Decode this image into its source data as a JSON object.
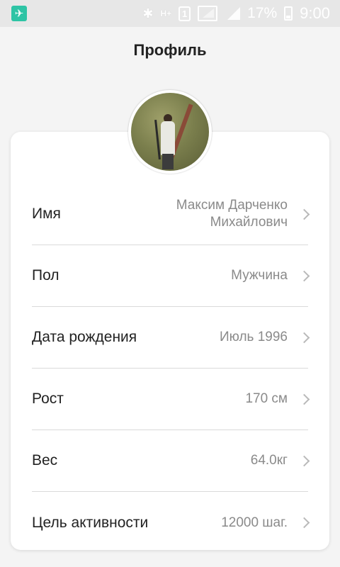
{
  "status_bar": {
    "battery": "17%",
    "time": "9:00",
    "sim_label": "1",
    "network_label": "H+"
  },
  "page": {
    "title": "Профиль"
  },
  "rows": [
    {
      "label": "Имя",
      "value_line1": "Максим Дарченко",
      "value_line2": "Михайлович"
    },
    {
      "label": "Пол",
      "value": "Мужчина"
    },
    {
      "label": "Дата рождения",
      "value": "Июль 1996"
    },
    {
      "label": "Рост",
      "value": "170 см"
    },
    {
      "label": "Вес",
      "value": "64.0кг"
    },
    {
      "label": "Цель активности",
      "value": "12000 шаг."
    }
  ],
  "colors": {
    "accent_notification": "#2ec4a5",
    "value_text": "#8a8a8a"
  }
}
